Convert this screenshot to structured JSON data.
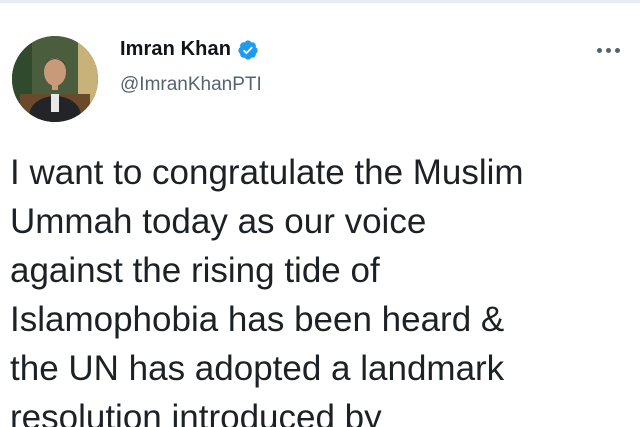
{
  "tweet": {
    "author": {
      "display_name": "Imran Khan",
      "handle": "@ImranKhanPTI",
      "verified": true,
      "avatar_icon": "profile-photo"
    },
    "more_icon": "more-options-icon",
    "text": "I want to congratulate the Muslim\nUmmah today as our voice\nagainst the rising tide of\nIslamophobia has been heard &\nthe UN has adopted a landmark\nresolution introduced by"
  },
  "colors": {
    "verified_blue": "#1d9bf0",
    "handle_gray": "#536471",
    "text_dark": "#0f1419"
  }
}
